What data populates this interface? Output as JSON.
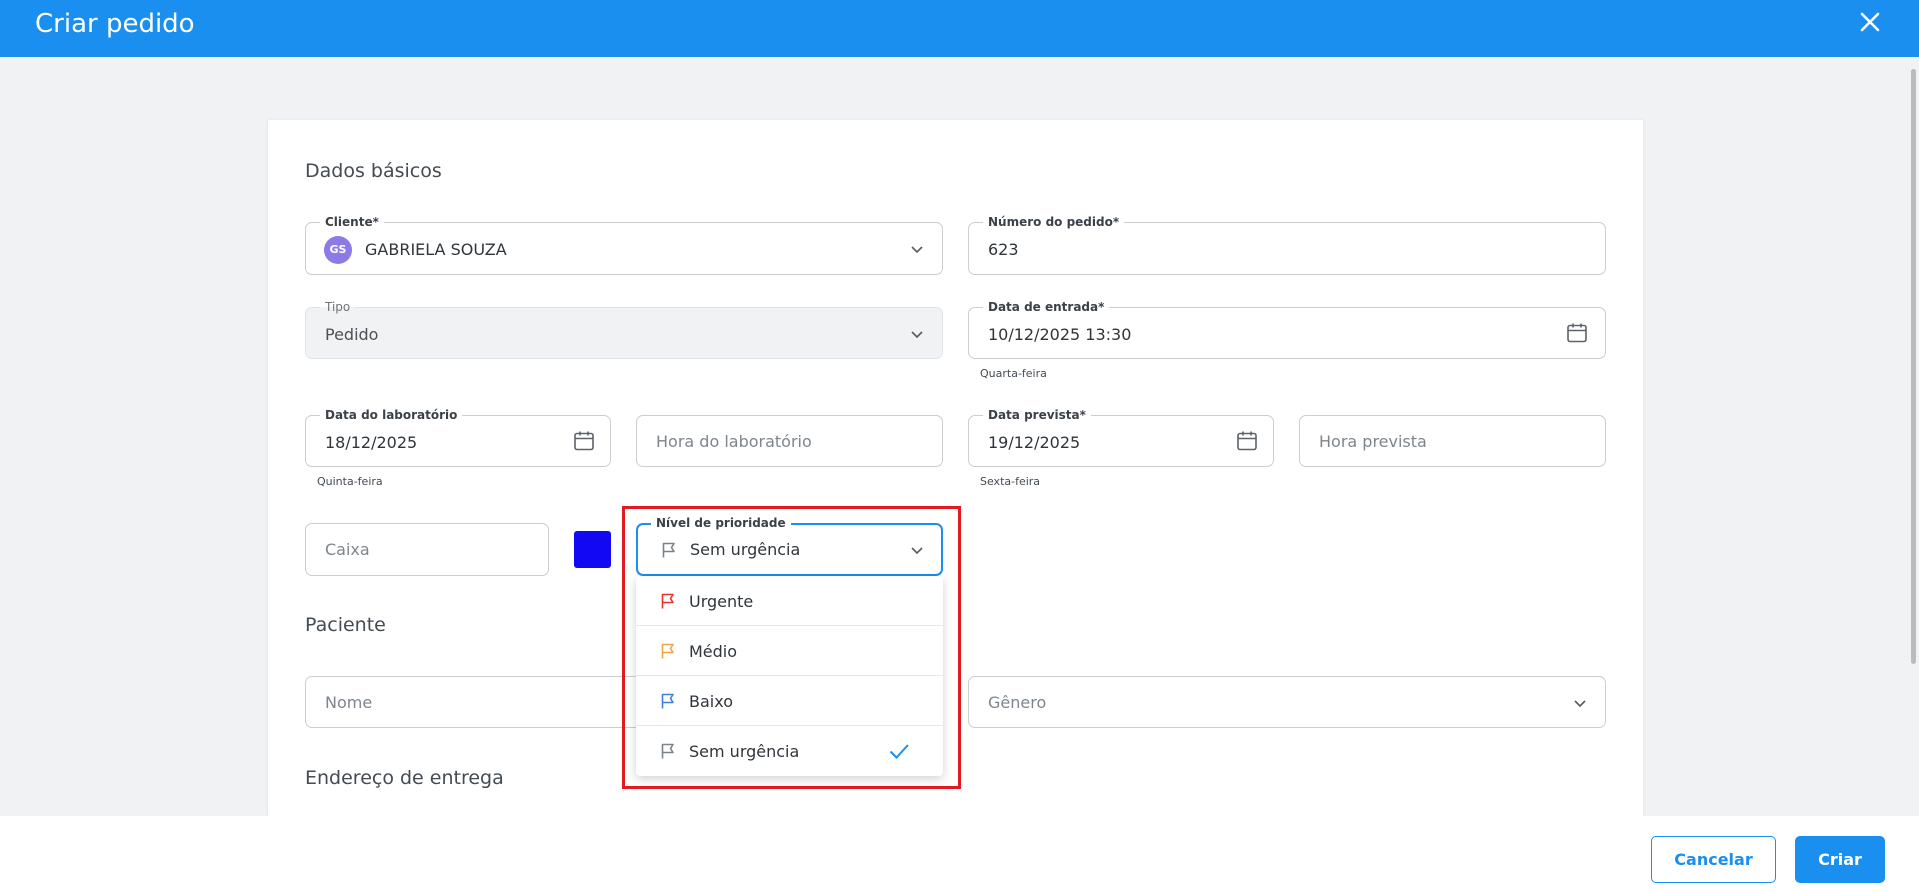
{
  "header": {
    "title": "Criar pedido"
  },
  "sections": {
    "basic": "Dados básicos",
    "patient": "Paciente",
    "address": "Endereço de entrega"
  },
  "fields": {
    "cliente": {
      "label": "Cliente*",
      "value": "GABRIELA SOUZA",
      "avatar": "GS"
    },
    "numero": {
      "label": "Número do pedido*",
      "value": "623"
    },
    "tipo": {
      "label": "Tipo",
      "value": "Pedido"
    },
    "entrada": {
      "label": "Data de entrada*",
      "value": "10/12/2025 13:30",
      "hint": "Quarta-feira"
    },
    "data_lab": {
      "label": "Data do laboratório",
      "value": "18/12/2025",
      "hint": "Quinta-feira"
    },
    "hora_lab": {
      "placeholder": "Hora do laboratório"
    },
    "data_prevista": {
      "label": "Data prevista*",
      "value": "19/12/2025",
      "hint": "Sexta-feira"
    },
    "hora_prevista": {
      "placeholder": "Hora prevista"
    },
    "caixa": {
      "placeholder": "Caixa"
    },
    "prioridade": {
      "label": "Nível de prioridade",
      "value": "Sem urgência"
    },
    "nome": {
      "placeholder": "Nome"
    },
    "genero": {
      "placeholder": "Gênero"
    }
  },
  "colors": {
    "box_color": "#1208f2",
    "accent": "#1a8fef",
    "urgent": "#e5342b",
    "medium": "#f0a24a",
    "low": "#3f7fd6",
    "none": "#7a828a"
  },
  "priority_options": [
    {
      "label": "Urgente",
      "icon": "flag-icon",
      "color": "#e5342b",
      "selected": false
    },
    {
      "label": "Médio",
      "icon": "flag-icon",
      "color": "#f0a24a",
      "selected": false
    },
    {
      "label": "Baixo",
      "icon": "flag-icon",
      "color": "#3f7fd6",
      "selected": false
    },
    {
      "label": "Sem urgência",
      "icon": "flag-icon",
      "color": "#7a828a",
      "selected": true
    }
  ],
  "footer": {
    "cancel": "Cancelar",
    "create": "Criar"
  }
}
